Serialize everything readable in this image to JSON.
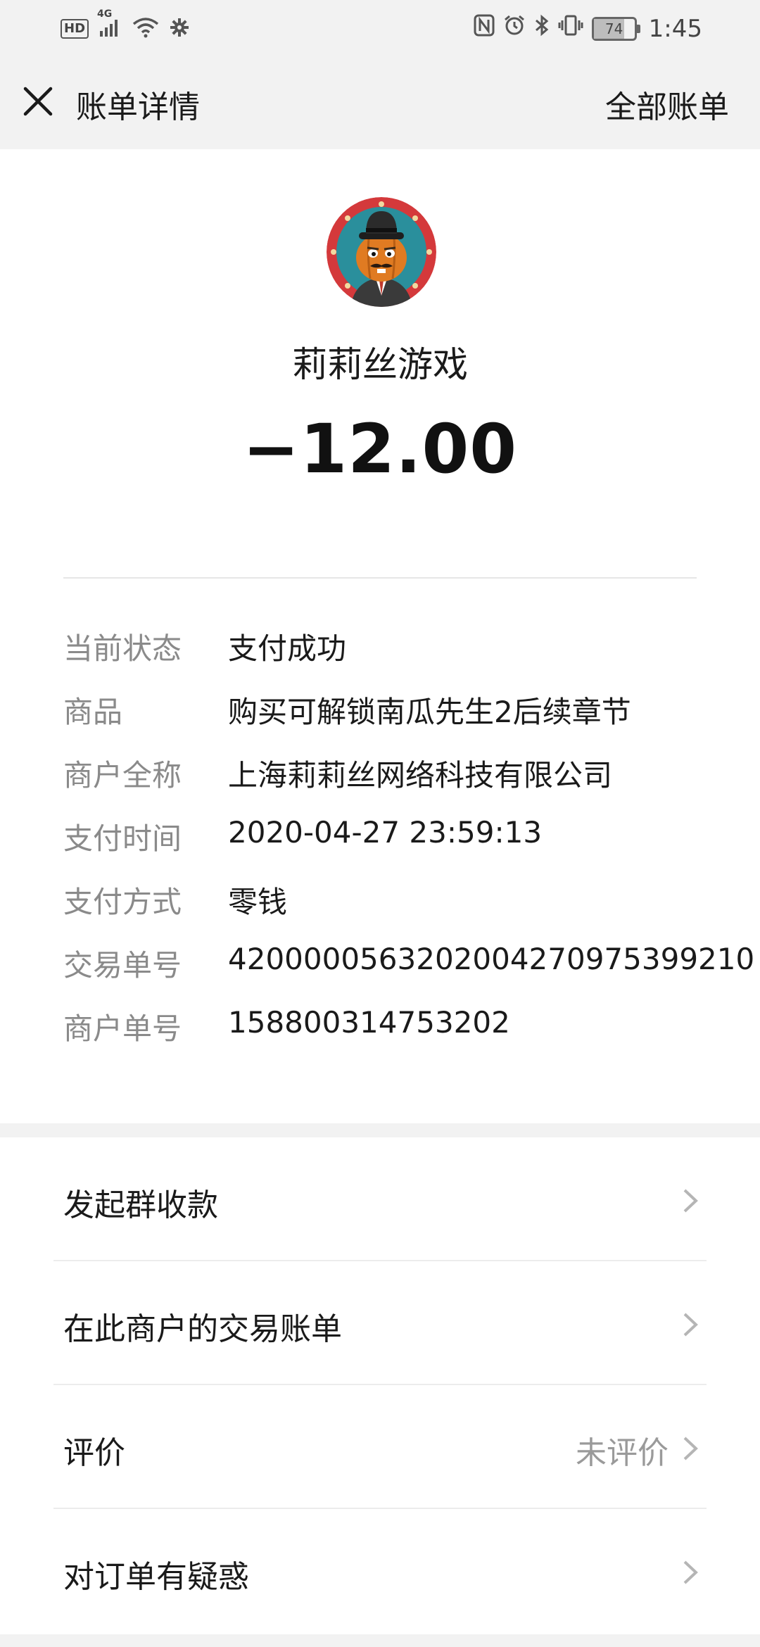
{
  "status_bar": {
    "hd": "HD",
    "network": "4G",
    "battery": "74",
    "battery_level": 0.74,
    "time": "1:45"
  },
  "header": {
    "title": "账单详情",
    "all_bills": "全部账单",
    "close_icon": "close-icon"
  },
  "merchant": {
    "name": "莉莉丝游戏",
    "amount": "−12.00"
  },
  "details": [
    {
      "label": "当前状态",
      "value": "支付成功"
    },
    {
      "label": "商品",
      "value": "购买可解锁南瓜先生2后续章节"
    },
    {
      "label": "商户全称",
      "value": "上海莉莉丝网络科技有限公司"
    },
    {
      "label": "支付时间",
      "value": "2020-04-27 23:59:13"
    },
    {
      "label": "支付方式",
      "value": "零钱"
    },
    {
      "label": "交易单号",
      "value": "4200000563202004270975399210"
    },
    {
      "label": "商户单号",
      "value": "158800314753202"
    }
  ],
  "actions": [
    {
      "label": "发起群收款",
      "value": ""
    },
    {
      "label": "在此商户的交易账单",
      "value": ""
    },
    {
      "label": "评价",
      "value": "未评价"
    },
    {
      "label": "对订单有疑惑",
      "value": ""
    }
  ],
  "colors": {
    "background": "#ffffff",
    "bar": "#f2f2f2",
    "label_gray": "#8a8a8a"
  }
}
